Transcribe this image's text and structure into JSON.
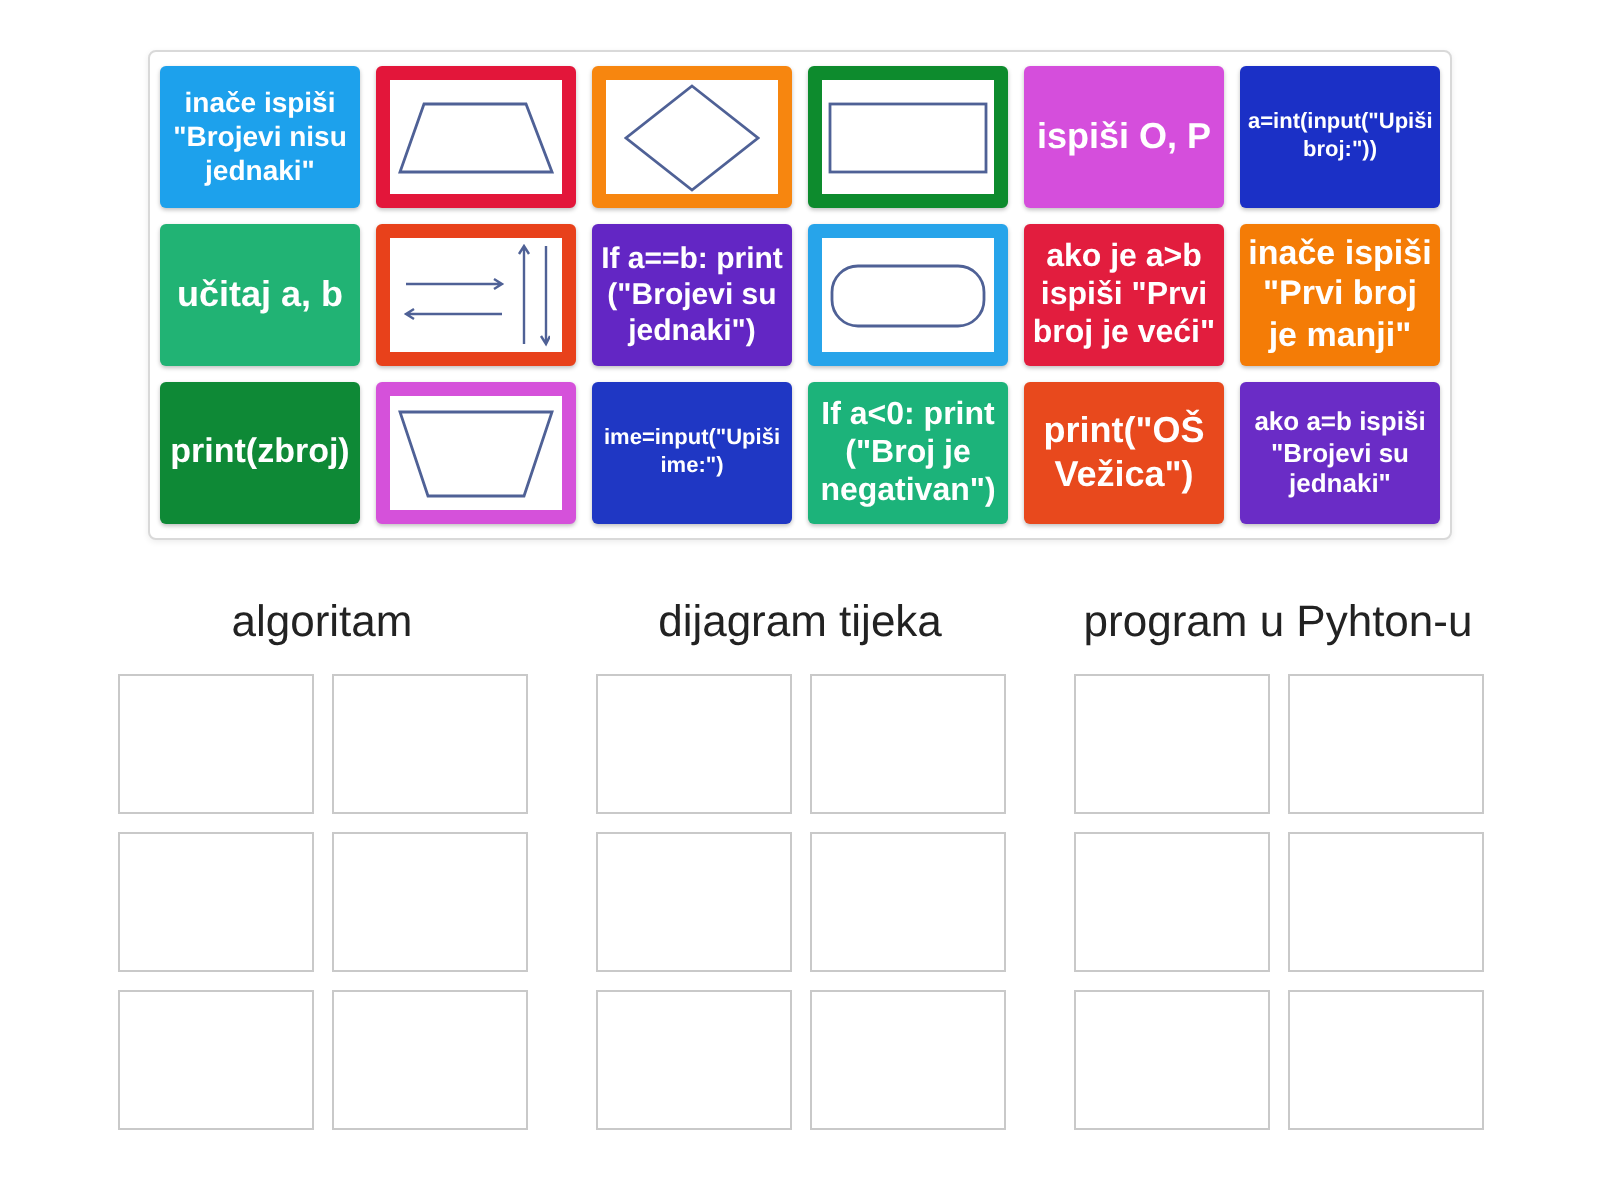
{
  "cards": [
    {
      "kind": "text",
      "text": "inače ispiši \"Brojevi nisu jednaki\"",
      "color": "#1da1ec"
    },
    {
      "kind": "trapezoid",
      "color": "#e3163a"
    },
    {
      "kind": "diamond",
      "color": "#f7860f"
    },
    {
      "kind": "rectangle",
      "color": "#0d8b2d"
    },
    {
      "kind": "text",
      "text": "ispiši O, P",
      "color": "#d54edc"
    },
    {
      "kind": "text",
      "text": "a=int(input(\"Upiši broj:\"))",
      "color": "#1b30c6"
    },
    {
      "kind": "text",
      "text": "učitaj a, b",
      "color": "#21b374"
    },
    {
      "kind": "arrows",
      "color": "#e8411b"
    },
    {
      "kind": "text",
      "text": "If a==b: print (\"Brojevi su jednaki\")",
      "color": "#6326c4"
    },
    {
      "kind": "rounded",
      "color": "#27a4ea"
    },
    {
      "kind": "text",
      "text": "ako je a>b ispiši \"Prvi broj je veći\"",
      "color": "#e21d3e"
    },
    {
      "kind": "text",
      "text": "inače ispiši \"Prvi broj je manji\"",
      "color": "#f47c06"
    },
    {
      "kind": "text",
      "text": "print(zbroj)",
      "color": "#0e8936"
    },
    {
      "kind": "funnel",
      "color": "#d551da"
    },
    {
      "kind": "text",
      "text": "ime=input(\"Upiši ime:\")",
      "color": "#1f37c4"
    },
    {
      "kind": "text",
      "text": "If a<0: print (\"Broj je negativan\")",
      "color": "#1cb37a"
    },
    {
      "kind": "text",
      "text": "print(\"OŠ Vežica\")",
      "color": "#e8491d"
    },
    {
      "kind": "text",
      "text": "ako a=b ispiši \"Brojevi su jednaki\"",
      "color": "#6a2cc6"
    }
  ],
  "groups": [
    {
      "title": "algoritam"
    },
    {
      "title": "dijagram tijeka"
    },
    {
      "title": "program u Pyhton-u"
    }
  ]
}
